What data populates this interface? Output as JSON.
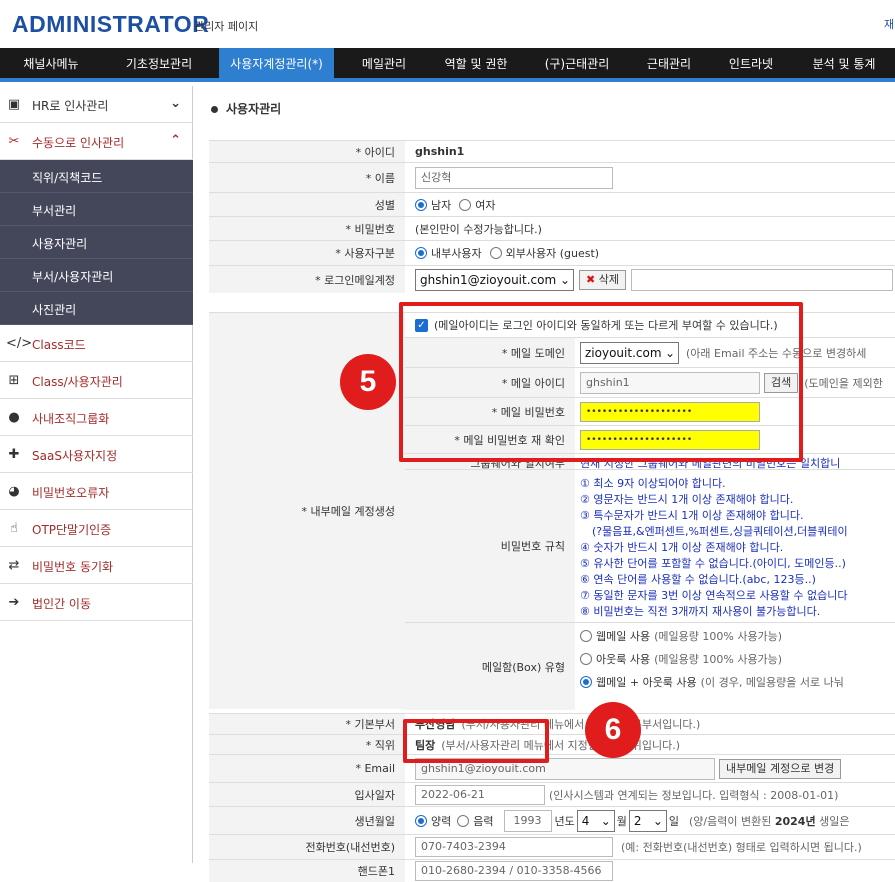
{
  "header": {
    "logo": "ADMINISTRATOR",
    "subtitle": "관리자 페이지",
    "link": "재"
  },
  "nav": [
    "채널사메뉴",
    "기초정보관리",
    "사용자계정관리(*)",
    "메일관리",
    "역할 및 권한",
    "(구)근태관리",
    "근태관리",
    "인트라넷",
    "분석 및 통계"
  ],
  "sidebar": {
    "hr": "HR로 인사관리",
    "manual": "수동으로 인사관리",
    "subs": [
      "직위/직책코드",
      "부서관리",
      "사용자관리",
      "부서/사용자관리",
      "사진관리"
    ],
    "items": [
      "Class코드",
      "Class/사용자관리",
      "사내조직그룹화",
      "SaaS사용자지정",
      "비밀번호오류자",
      "OTP단말기인증",
      "비밀번호 동기화",
      "법인간 이동"
    ]
  },
  "page_title": "사용자관리",
  "form": {
    "id_label": "* 아이디",
    "id_value": "ghshin1",
    "name_label": "* 이름",
    "name_value": "신강혁",
    "gender_label": "성별",
    "male": "남자",
    "female": "여자",
    "pw_label": "* 비밀번호",
    "pw_note": "(본인만이 수정가능합니다.)",
    "usertype_label": "* 사용자구분",
    "internal": "내부사용자",
    "external": "외부사용자 (guest)",
    "loginmail_label": "* 로그인메일계정",
    "loginmail_value": "ghshin1@zioyouit.com",
    "delete_btn": "삭제",
    "mail_check_text": "(메일아이디는 로그인 아이디와 동일하게 또는 다르게 부여할 수 있습니다.)",
    "mail_domain_label": "* 메일 도메인",
    "mail_domain_value": "zioyouit.com",
    "mail_domain_note": "(아래 Email 주소는 수동으로 변경하세",
    "mail_id_label": "* 메일 아이디",
    "mail_id_value": "ghshin1",
    "search_btn": "검색",
    "mail_id_note": "(도메인을 제외한",
    "mail_pw_label": "* 메일 비밀번호",
    "mail_pw_value": "••••••••••••••••••••",
    "mail_pw2_label": "* 메일 비밀번호 재 확인",
    "mail_pw2_value": "••••••••••••••••••••",
    "groupware_label": "그룹웨어와 일치여부",
    "groupware_note": "현재 지정한 그룹웨어와 메일관련의 비밀번호는 일치합니",
    "internal_mail_label": "* 내부메일 계정생성",
    "pw_rule_label": "비밀번호 규칙",
    "pw_rules": [
      "① 최소 9자 이상되어야 합니다.",
      "② 영문자는 반드시 1개 이상 존재해야 합니다.",
      "③ 특수문자가 반드시 1개 이상 존재해야 합니다.",
      "(?물음표,&엔퍼센트,%퍼센트,싱글쿼테이션,더블쿼테이",
      "④ 숫자가 반드시 1개 이상 존재해야 합니다.",
      "⑤ 유사한 단어를 포함할 수 없습니다.(아이디, 도메인등..)",
      "⑥ 연속 단어를 사용할 수 없습니다.(abc, 123등..)",
      "⑦ 동일한 문자를 3번 이상 연속적으로 사용할 수 없습니다",
      "⑧ 비밀번호는 직전 3개까지 재사용이 불가능합니다."
    ],
    "mailbox_label": "메일함(Box) 유형",
    "mailbox_opts": [
      {
        "name": "웹메일 사용",
        "note": "(메일용량 100% 사용가능)"
      },
      {
        "name": "아웃룩 사용",
        "note": "(메일용량 100% 사용가능)"
      },
      {
        "name": "웹메일 + 아웃룩 사용",
        "note": "(이 경우, 메일용량을 서로 나눠"
      }
    ],
    "dept_label": "* 기본부서",
    "dept_value": "부산영남",
    "dept_note": "(부서/사용자관리 메뉴에서 지정한 기본부서입니다.)",
    "position_label": "* 직위",
    "position_value": "팀장",
    "position_note": "(부서/사용자관리 메뉴에서 지정한 기본직위입니다.)",
    "email_label": "* Email",
    "email_value": "ghshin1@zioyouit.com",
    "email_btn": "내부메일 계정으로 변경",
    "join_label": "입사일자",
    "join_value": "2022-06-21",
    "join_note": "(인사시스템과 연계되는 정보입니다. 입력형식 : 2008-01-01)",
    "birth_label": "생년월일",
    "solar": "양력",
    "lunar": "음력",
    "birth_year": "1993",
    "year_unit": "년도",
    "birth_month": "4",
    "month_unit": "월",
    "birth_day": "2",
    "day_unit": "일",
    "birth_note_pre": "(양/음력이 변환된 ",
    "birth_note_bold": "2024년",
    "birth_note_post": " 생일은",
    "phone_label": "전화번호(내선번호)",
    "phone_value": "070-7403-2394",
    "phone_note": "(예: 전화번호(내선번호) 형태로 입력하시면 됩니다.)",
    "mobile_label": "핸드폰1",
    "mobile_value": "010-2680-2394 / 010-3358-4566"
  },
  "annotations": {
    "step5": "5",
    "step6": "6"
  },
  "colors": {
    "nav_bg": "#1a1a1a",
    "nav_active": "#2f7fd1",
    "logo": "#1d4fa3",
    "annot": "#e01c1c",
    "pw_fill": "#ffff00"
  }
}
